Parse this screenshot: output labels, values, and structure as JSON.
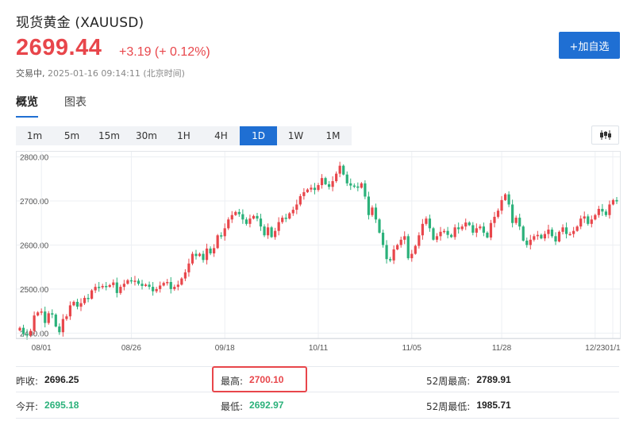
{
  "header": {
    "title": "现货黄金 (XAUUSD)",
    "price": "2699.44",
    "change": "+3.19 (+ 0.12%)",
    "status": "交易中,",
    "timestamp": "2025-01-16 09:14:11 (北京时间)",
    "add_button": "+加自选"
  },
  "tabs": [
    "概览",
    "图表"
  ],
  "ranges": [
    "1m",
    "5m",
    "15m",
    "30m",
    "1H",
    "4H",
    "1D",
    "1W",
    "1M"
  ],
  "active_range": "1D",
  "colors": {
    "up": "#e8464b",
    "down": "#2bb17a",
    "accent": "#1f6fd3"
  },
  "stats": {
    "prev_close_label": "昨收:",
    "prev_close": "2696.25",
    "high_label": "最高:",
    "high": "2700.10",
    "high52_label": "52周最高:",
    "high52": "2789.91",
    "open_label": "今开:",
    "open": "2695.18",
    "low_label": "最低:",
    "low": "2692.97",
    "low52_label": "52周最低:",
    "low52": "1985.71"
  },
  "chart_data": {
    "type": "candlestick",
    "y_ticks": [
      "2800.00",
      "2700.00",
      "2600.00",
      "2500.00",
      "2400.00"
    ],
    "x_ticks": [
      "08/01",
      "08/26",
      "09/18",
      "10/11",
      "11/05",
      "11/28",
      "12/23",
      "01/1"
    ],
    "ylim": [
      2388,
      2810
    ],
    "grid": true,
    "series_close": [
      2412,
      2398,
      2395,
      2405,
      2440,
      2447,
      2449,
      2423,
      2445,
      2442,
      2415,
      2402,
      2432,
      2438,
      2463,
      2471,
      2460,
      2468,
      2480,
      2478,
      2497,
      2505,
      2504,
      2507,
      2505,
      2509,
      2515,
      2491,
      2505,
      2512,
      2520,
      2518,
      2519,
      2512,
      2507,
      2510,
      2505,
      2495,
      2500,
      2508,
      2514,
      2516,
      2500,
      2505,
      2510,
      2524,
      2538,
      2558,
      2580,
      2575,
      2580,
      2566,
      2592,
      2581,
      2593,
      2622,
      2620,
      2638,
      2658,
      2668,
      2675,
      2670,
      2658,
      2648,
      2660,
      2666,
      2660,
      2642,
      2622,
      2640,
      2618,
      2632,
      2652,
      2662,
      2660,
      2672,
      2680,
      2692,
      2711,
      2720,
      2726,
      2730,
      2725,
      2736,
      2752,
      2738,
      2732,
      2745,
      2762,
      2780,
      2760,
      2740,
      2735,
      2733,
      2730,
      2740,
      2710,
      2668,
      2685,
      2658,
      2628,
      2600,
      2568,
      2565,
      2590,
      2600,
      2612,
      2620,
      2570,
      2580,
      2598,
      2622,
      2648,
      2660,
      2638,
      2612,
      2620,
      2630,
      2632,
      2623,
      2618,
      2640,
      2636,
      2642,
      2651,
      2645,
      2628,
      2638,
      2642,
      2628,
      2617,
      2650,
      2664,
      2678,
      2702,
      2715,
      2692,
      2650,
      2662,
      2642,
      2610,
      2600,
      2612,
      2620,
      2623,
      2615,
      2625,
      2635,
      2620,
      2608,
      2630,
      2640,
      2625,
      2625,
      2632,
      2642,
      2660,
      2665,
      2648,
      2658,
      2668,
      2682,
      2676,
      2668,
      2692,
      2702,
      2699
    ]
  }
}
